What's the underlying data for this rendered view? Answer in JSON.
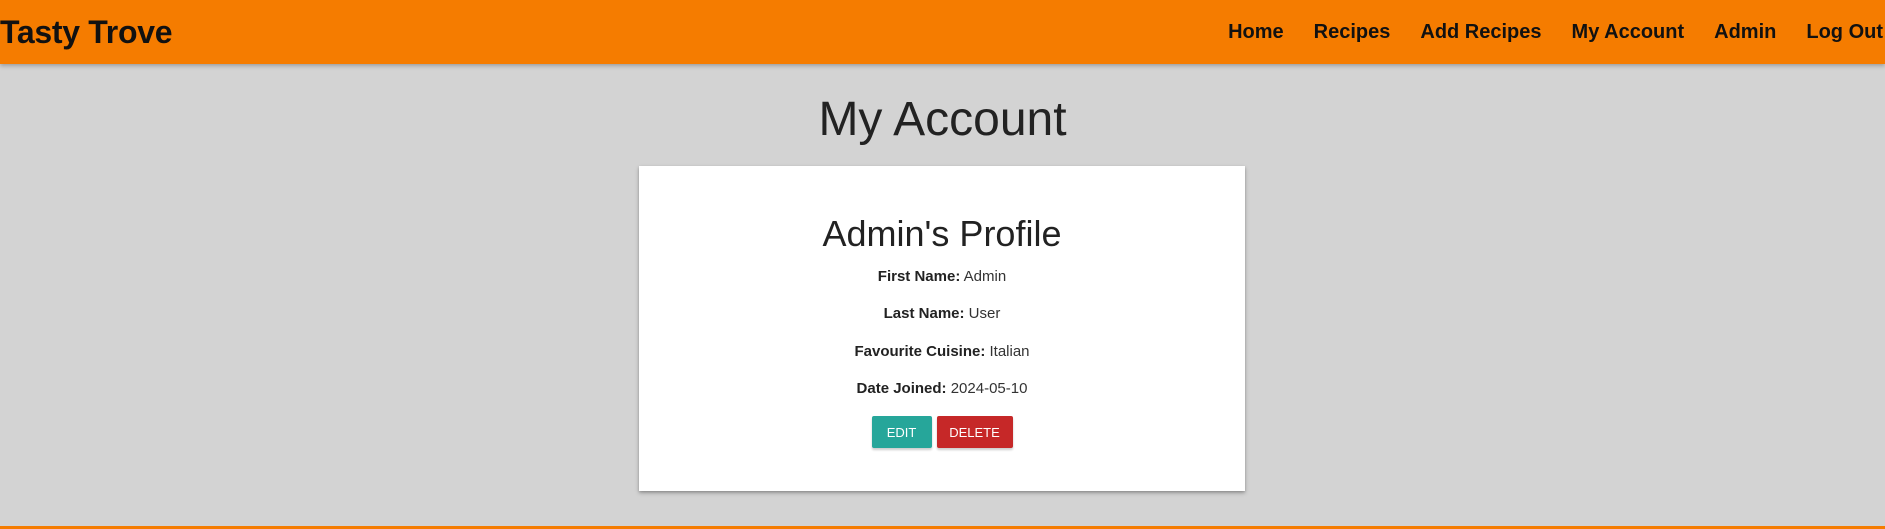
{
  "navbar": {
    "brand": "Tasty Trove",
    "links": [
      "Home",
      "Recipes",
      "Add Recipes",
      "My Account",
      "Admin",
      "Log Out"
    ],
    "color": "#f57c00"
  },
  "page": {
    "title": "My Account",
    "background": "#d3d3d3"
  },
  "profile": {
    "title": "Admin's Profile",
    "fields": [
      {
        "label": "First Name:",
        "value": "Admin"
      },
      {
        "label": "Last Name:",
        "value": "User"
      },
      {
        "label": "Favourite Cuisine:",
        "value": "Italian"
      },
      {
        "label": "Date Joined:",
        "value": "2024-05-10"
      }
    ],
    "edit_label": "EDIT",
    "delete_label": "DELETE",
    "edit_color": "#26a69a",
    "delete_color": "#c62828"
  }
}
